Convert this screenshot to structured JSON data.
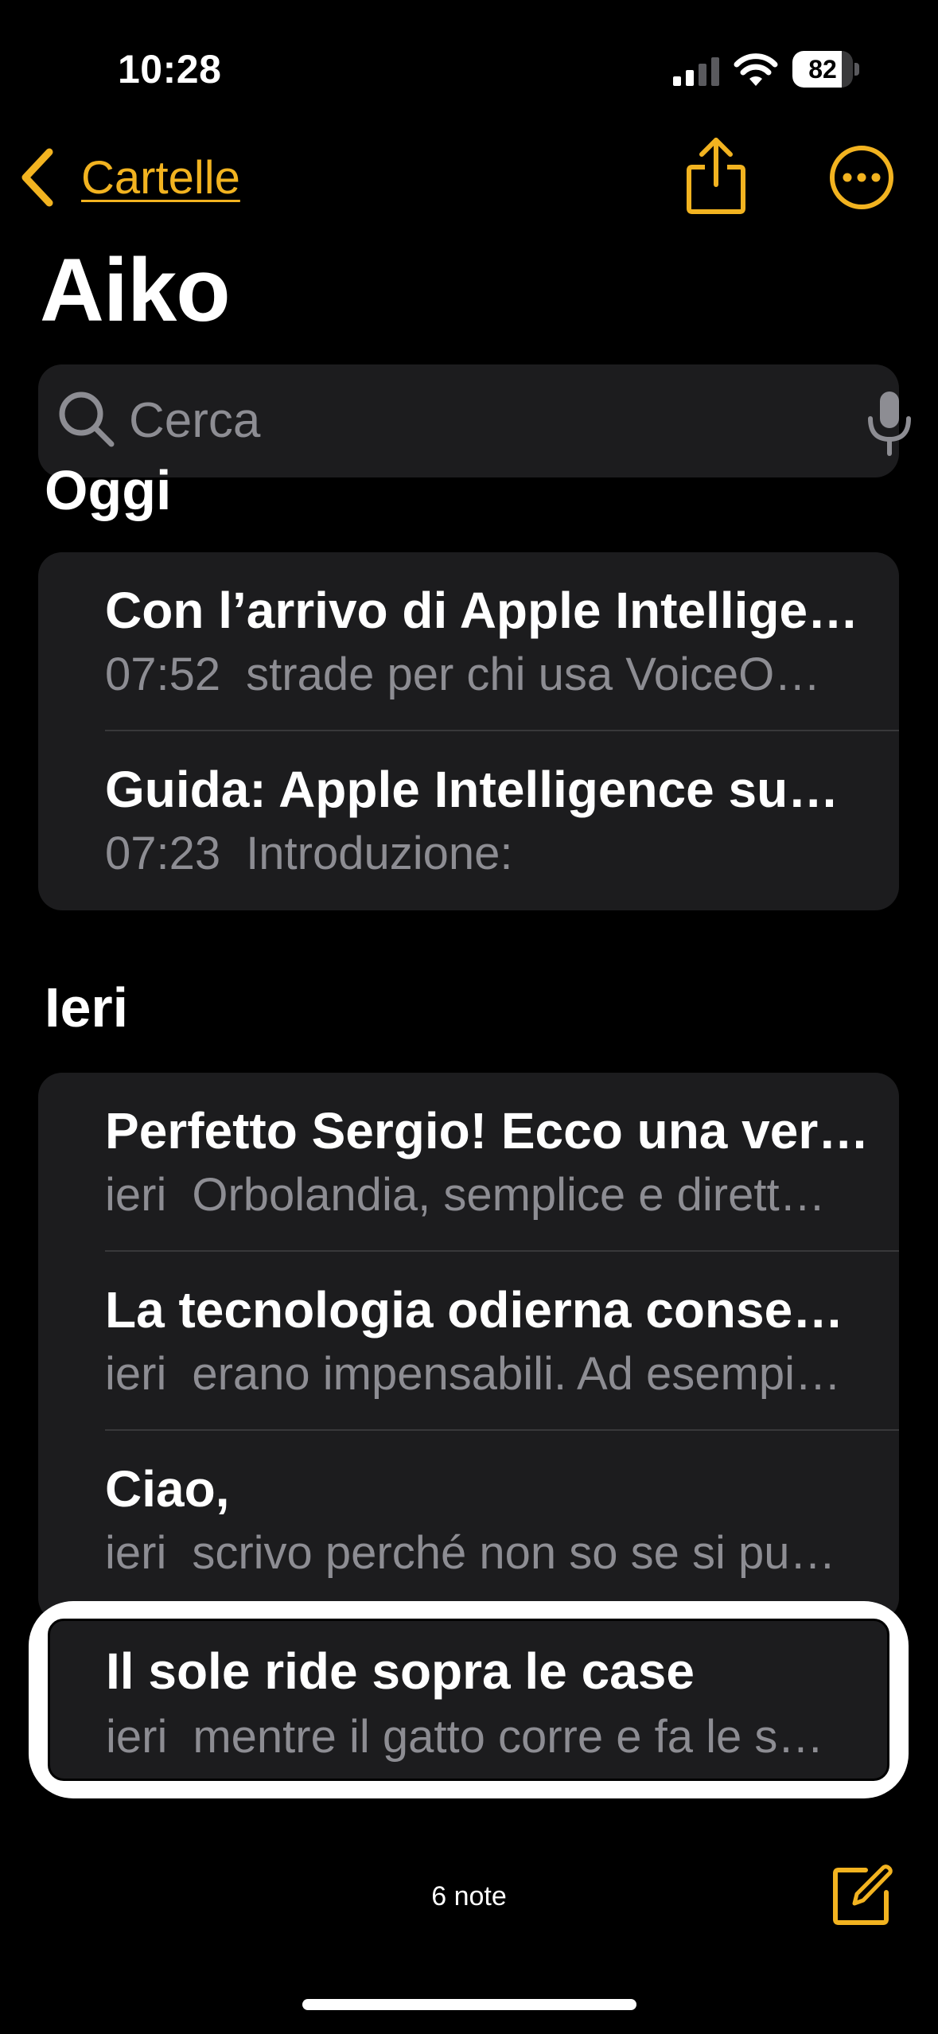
{
  "status_bar": {
    "time": "10:28",
    "battery_level": "82",
    "battery_fraction": 0.82
  },
  "nav": {
    "back_label": "Cartelle",
    "accent_color": "#f2b320"
  },
  "page_title": "Aiko",
  "search": {
    "placeholder": "Cerca"
  },
  "sections": [
    {
      "title": "Oggi",
      "notes": [
        {
          "title": "Con l’arrivo di Apple Intellige…",
          "date": "07:52",
          "preview": "strade per chi usa VoiceO…"
        },
        {
          "title": "Guida: Apple Intelligence su…",
          "date": "07:23",
          "preview": "Introduzione:"
        }
      ]
    },
    {
      "title": "Ieri",
      "notes": [
        {
          "title": "Perfetto Sergio! Ecco una ver…",
          "date": "ieri",
          "preview": "Orbolandia, semplice e dirett…"
        },
        {
          "title": "La tecnologia odierna conse…",
          "date": "ieri",
          "preview": "erano impensabili. Ad esempi…"
        },
        {
          "title": "Ciao,",
          "date": "ieri",
          "preview": "scrivo perché non so se si pu…"
        }
      ]
    }
  ],
  "highlighted_note": {
    "title": "Il sole ride sopra le case",
    "date": "ieri",
    "preview": "mentre il gatto corre e fa le s…"
  },
  "footer": {
    "note_count": "6 note"
  },
  "icons": {
    "back": "chevron-left-icon",
    "share": "share-icon",
    "more": "ellipsis-circle-icon",
    "search": "search-icon",
    "mic": "microphone-icon",
    "compose": "compose-icon"
  }
}
